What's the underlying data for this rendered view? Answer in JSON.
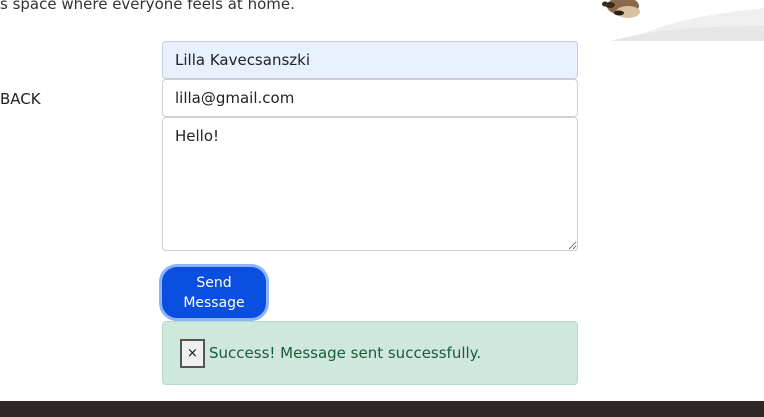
{
  "header": {
    "tagline": "s space where everyone feels at home."
  },
  "nav": {
    "back_label": "BACK"
  },
  "form": {
    "name_value": "Lilla Kavecsanszki",
    "email_value": "lilla@gmail.com",
    "message_value": "Hello!",
    "submit_label": "Send Message"
  },
  "alert": {
    "close_label": "×",
    "message": "Success! Message sent successfully."
  },
  "colors": {
    "accent": "#0b4fe0",
    "success_bg": "#cfe8dc",
    "success_text": "#1d5a3c",
    "footer": "#2f2626"
  },
  "icons": {
    "hero": "dog-illustration",
    "close": "close-icon"
  }
}
